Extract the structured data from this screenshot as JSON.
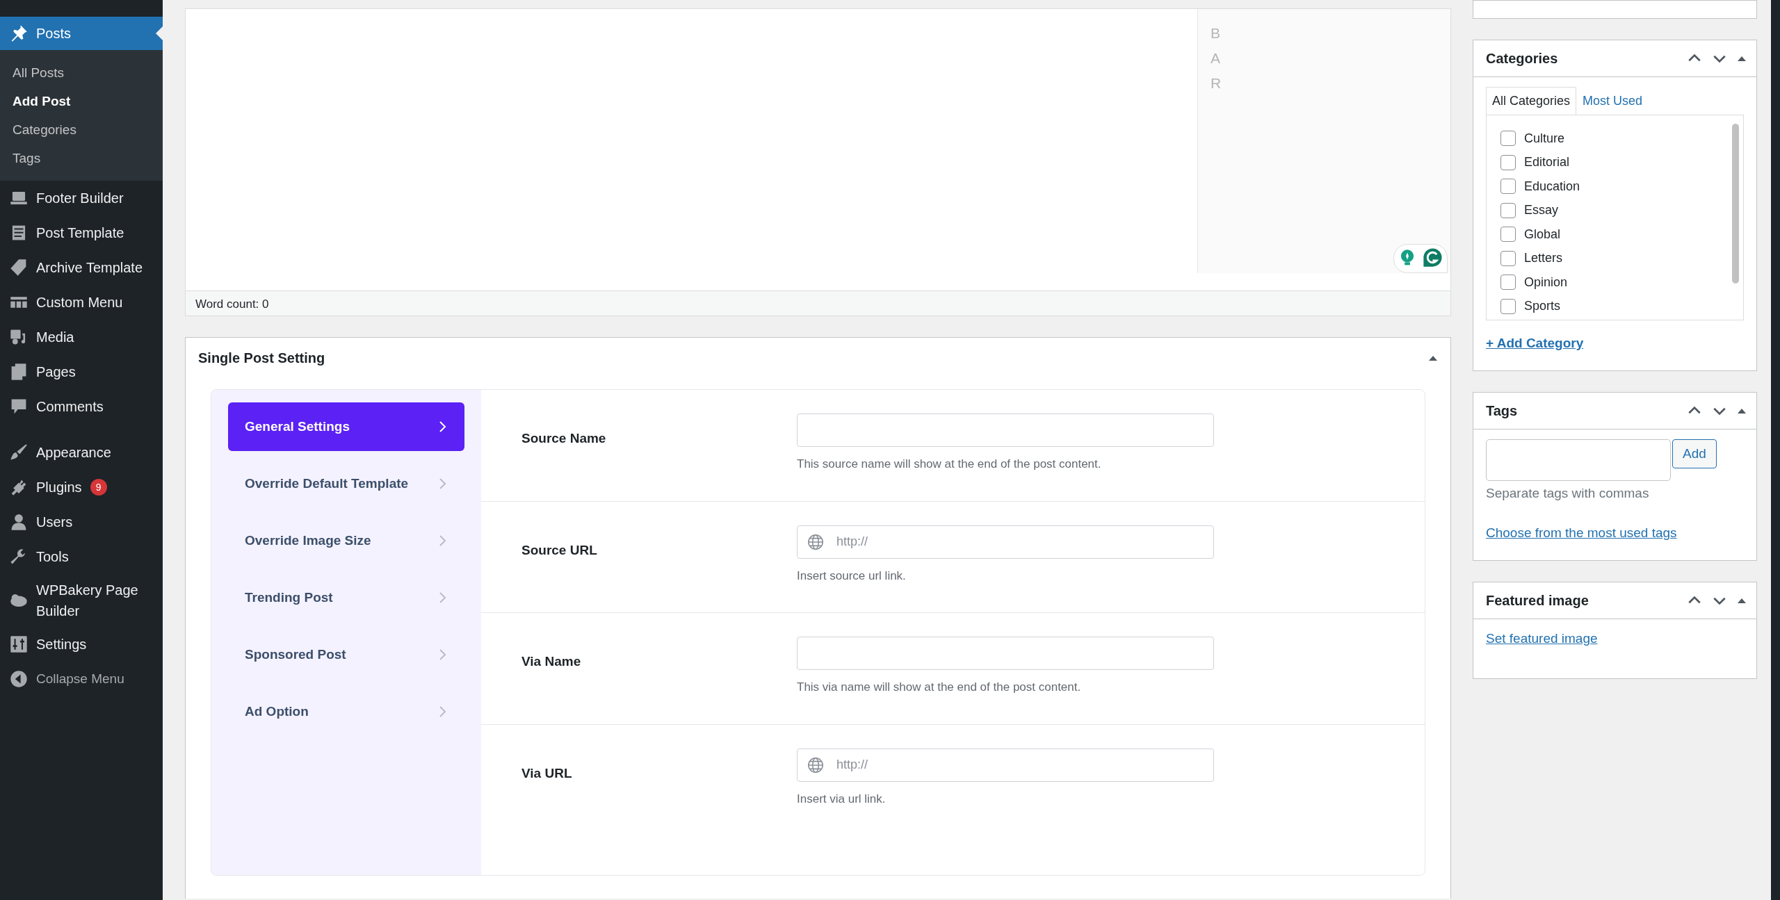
{
  "admin_menu": {
    "items": [
      {
        "label": "Posts",
        "current": true,
        "children": [
          {
            "label": "All Posts",
            "selected": false
          },
          {
            "label": "Add Post",
            "selected": true
          },
          {
            "label": "Categories",
            "selected": false
          },
          {
            "label": "Tags",
            "selected": false
          }
        ]
      },
      {
        "label": "Footer Builder",
        "current": false
      },
      {
        "label": "Post Template",
        "current": false
      },
      {
        "label": "Archive Template",
        "current": false
      },
      {
        "label": "Custom Menu",
        "current": false
      },
      {
        "label": "Media",
        "current": false
      },
      {
        "label": "Pages",
        "current": false
      },
      {
        "label": "Comments",
        "current": false
      },
      {
        "kind": "separator"
      },
      {
        "label": "Appearance",
        "current": false
      },
      {
        "label": "Plugins",
        "current": false,
        "badge": "9"
      },
      {
        "label": "Users",
        "current": false
      },
      {
        "label": "Tools",
        "current": false
      },
      {
        "label": "WPBakery Page Builder",
        "current": false
      },
      {
        "label": "Settings",
        "current": false
      }
    ],
    "collapse": {
      "label": "Collapse Menu"
    }
  },
  "editor": {
    "side_letters": [
      "B",
      "A",
      "R"
    ],
    "word_count": "Word count: 0"
  },
  "single_post_setting": {
    "title": "Single Post Setting",
    "nav": [
      {
        "label": "General Settings",
        "selected": true
      },
      {
        "label": "Override Default Template",
        "selected": false
      },
      {
        "label": "Override Image Size",
        "selected": false
      },
      {
        "label": "Trending Post",
        "selected": false
      },
      {
        "label": "Sponsored Post",
        "selected": false
      },
      {
        "label": "Ad Option",
        "selected": false
      }
    ],
    "fields": [
      {
        "kind": "text",
        "label": "Source Name",
        "help": "This source name will show at the end of the post content."
      },
      {
        "kind": "url",
        "label": "Source URL",
        "placeholder": "http://",
        "help": "Insert source url link."
      },
      {
        "kind": "text",
        "label": "Via Name",
        "help": "This via name will show at the end of the post content."
      },
      {
        "kind": "url",
        "label": "Via URL",
        "placeholder": "http://",
        "help": "Insert via url link."
      }
    ]
  },
  "categories": {
    "title": "Categories",
    "tabs": [
      {
        "label": "All Categories",
        "selected": true
      },
      {
        "label": "Most Used",
        "selected": false
      }
    ],
    "items": [
      {
        "label": "Culture",
        "checked": false
      },
      {
        "label": "Editorial",
        "checked": false
      },
      {
        "label": "Education",
        "checked": false
      },
      {
        "label": "Essay",
        "checked": false
      },
      {
        "label": "Global",
        "checked": false
      },
      {
        "label": "Letters",
        "checked": false
      },
      {
        "label": "Opinion",
        "checked": false
      },
      {
        "label": "Sports",
        "checked": false
      }
    ],
    "add_link": "+ Add Category"
  },
  "tags": {
    "title": "Tags",
    "button": "Add",
    "hint": "Separate tags with commas",
    "link": "Choose from the most used tags"
  },
  "featured_image": {
    "title": "Featured image",
    "link": "Set featured image"
  }
}
